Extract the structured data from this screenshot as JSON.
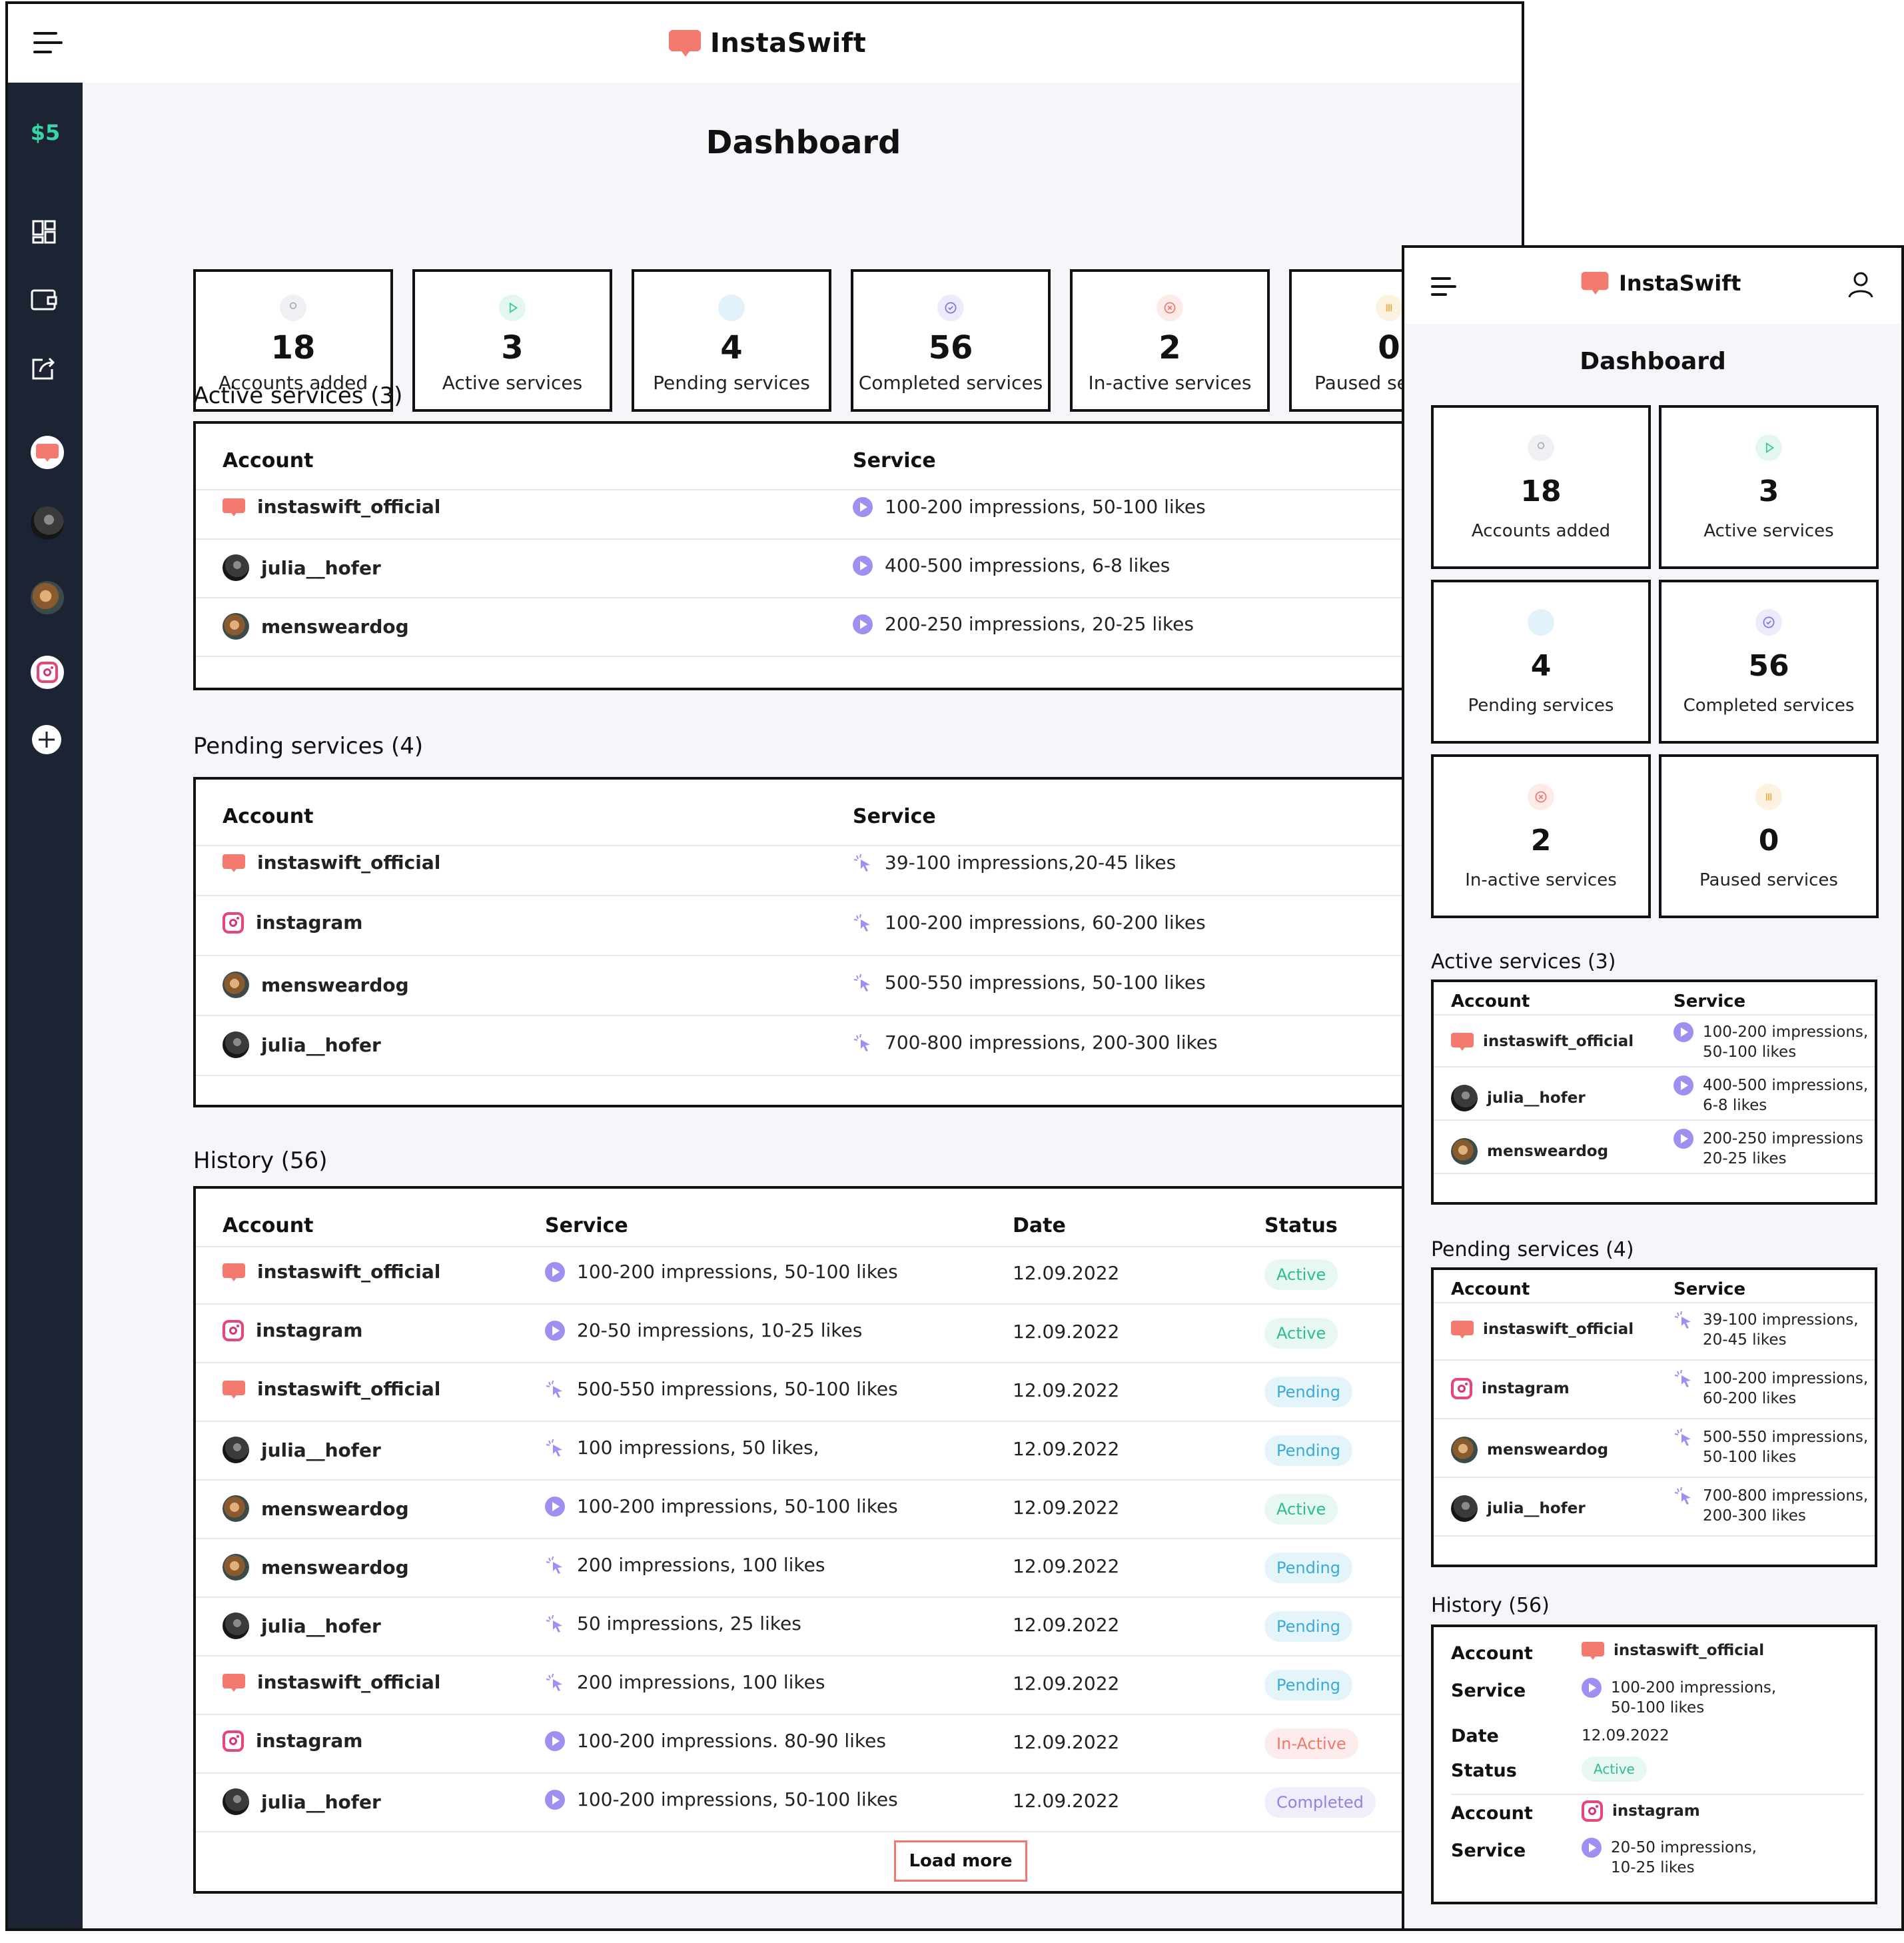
{
  "app_name": "InstaSwift",
  "balance": "$5",
  "page_title": "Dashboard",
  "stats": [
    {
      "value": "18",
      "label": "Accounts added",
      "icon": "user-icon",
      "color": "#a9adb6",
      "tint": "#eef0f3"
    },
    {
      "value": "3",
      "label": "Active services",
      "icon": "play-icon",
      "color": "#38c79b",
      "tint": "#e3f7f0"
    },
    {
      "value": "4",
      "label": "Pending services",
      "icon": "share-icon",
      "color": "#47aee0",
      "tint": "#e1f2fb"
    },
    {
      "value": "56",
      "label": "Completed services",
      "icon": "check-circle-icon",
      "color": "#7f74e1",
      "tint": "#ecebfb"
    },
    {
      "value": "2",
      "label": "In-active services",
      "icon": "cancel-circle-icon",
      "color": "#f0786e",
      "tint": "#fdebea"
    },
    {
      "value": "0",
      "label": "Paused services",
      "icon": "pause-icon",
      "color": "#f2a73b",
      "tint": "#fdf2e0"
    }
  ],
  "active": {
    "title": "Active services (3)",
    "col_account": "Account",
    "col_service": "Service",
    "rows": [
      {
        "account": "instaswift_official",
        "avatar": "logo",
        "service": "100-200 impressions, 50-100 likes",
        "m_service": "100-200 impressions,\n50-100 likes",
        "icon": "play"
      },
      {
        "account": "julia__hofer",
        "avatar": "julia",
        "service": "400-500 impressions, 6-8 likes",
        "m_service": "400-500 impressions,\n6-8 likes",
        "icon": "play"
      },
      {
        "account": "mensweardog",
        "avatar": "dog",
        "service": "200-250  impressions, 20-25 likes",
        "m_service": "200-250 impressions\n20-25 likes",
        "icon": "play"
      }
    ]
  },
  "pending": {
    "title": "Pending services (4)",
    "col_account": "Account",
    "col_service": "Service",
    "rows": [
      {
        "account": "instaswift_official",
        "avatar": "logo",
        "service": "39-100 impressions,20-45 likes",
        "m_service": "39-100 impressions,\n20-45 likes",
        "icon": "click"
      },
      {
        "account": "instagram",
        "avatar": "ig",
        "service": "100-200 impressions, 60-200 likes",
        "m_service": "100-200 impressions,\n60-200 likes",
        "icon": "click"
      },
      {
        "account": "mensweardog",
        "avatar": "dog",
        "service": "500-550 impressions, 50-100 likes",
        "m_service": "500-550 impressions,\n50-100 likes",
        "icon": "click"
      },
      {
        "account": "julia__hofer",
        "avatar": "julia",
        "service": "700-800 impressions, 200-300 likes",
        "m_service": "700-800 impressions,\n200-300 likes",
        "icon": "click"
      }
    ]
  },
  "history": {
    "title": "History (56)",
    "col_account": "Account",
    "col_service": "Service",
    "col_date": "Date",
    "col_status": "Status",
    "rows": [
      {
        "account": "instaswift_official",
        "avatar": "logo",
        "service": "100-200 impressions, 50-100 likes",
        "icon": "play",
        "date": "12.09.2022",
        "status": "Active",
        "kind": "active"
      },
      {
        "account": "instagram",
        "avatar": "ig",
        "service": "20-50 impressions, 10-25 likes",
        "icon": "play",
        "date": "12.09.2022",
        "status": "Active",
        "kind": "active"
      },
      {
        "account": "instaswift_official",
        "avatar": "logo",
        "service": "500-550 impressions, 50-100 likes",
        "icon": "click",
        "date": "12.09.2022",
        "status": "Pending",
        "kind": "pending"
      },
      {
        "account": "julia__hofer",
        "avatar": "julia",
        "service": "100 impressions, 50 likes,",
        "icon": "click",
        "date": "12.09.2022",
        "status": "Pending",
        "kind": "pending"
      },
      {
        "account": "mensweardog",
        "avatar": "dog",
        "service": "100-200 impressions, 50-100 likes",
        "icon": "play",
        "date": "12.09.2022",
        "status": "Active",
        "kind": "active"
      },
      {
        "account": "mensweardog",
        "avatar": "dog",
        "service": "200 impressions, 100 likes",
        "icon": "click",
        "date": "12.09.2022",
        "status": "Pending",
        "kind": "pending"
      },
      {
        "account": "julia__hofer",
        "avatar": "julia",
        "service": "50 impressions, 25 likes",
        "icon": "click",
        "date": "12.09.2022",
        "status": "Pending",
        "kind": "pending"
      },
      {
        "account": "instaswift_official",
        "avatar": "logo",
        "service": "200 impressions, 100 likes",
        "icon": "click",
        "date": "12.09.2022",
        "status": "Pending",
        "kind": "pending"
      },
      {
        "account": "instagram",
        "avatar": "ig",
        "service": "100-200 impressions. 80-90 likes",
        "icon": "play",
        "date": "12.09.2022",
        "status": "In-Active",
        "kind": "inactive"
      },
      {
        "account": "julia__hofer",
        "avatar": "julia",
        "service": "100-200 impressions, 50-100 likes",
        "icon": "play",
        "date": "12.09.2022",
        "status": "Completed",
        "kind": "completed"
      }
    ],
    "load_more": "Load more",
    "mobile_cards": [
      {
        "account": "instaswift_official",
        "avatar": "logo",
        "service": "100-200 impressions,\n50-100 likes",
        "icon": "play",
        "date": "12.09.2022",
        "status": "Active",
        "kind": "active"
      },
      {
        "account": "instagram",
        "avatar": "ig",
        "service": "20-50 impressions,\n10-25 likes",
        "icon": "play"
      }
    ],
    "label_account": "Account",
    "label_service": "Service",
    "label_date": "Date",
    "label_status": "Status"
  }
}
